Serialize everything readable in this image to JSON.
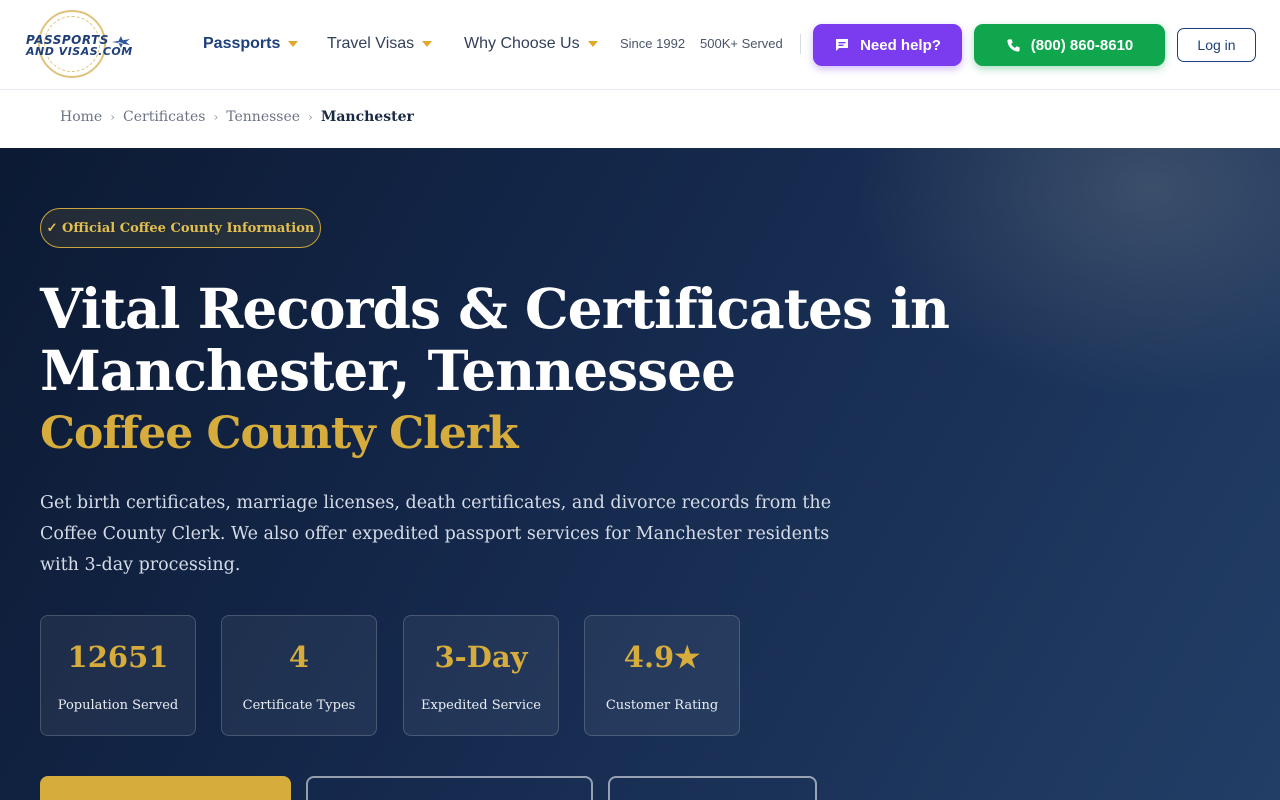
{
  "header": {
    "logo": {
      "line1": "PASSPORTS",
      "line2": "AND VISAS.COM",
      "icon": "plane-icon"
    },
    "nav": [
      {
        "label": "Passports",
        "active": true
      },
      {
        "label": "Travel Visas",
        "active": false
      },
      {
        "label": "Why Choose Us",
        "active": false
      }
    ],
    "since": "Since 1992",
    "served": "500K+ Served",
    "help_label": "Need help?",
    "phone_label": "(800) 860-8610",
    "login_label": "Log in",
    "colors": {
      "help": "#7b3cf0",
      "phone": "#0fa64e",
      "accent": "#d6ad3c"
    }
  },
  "breadcrumb": {
    "items": [
      "Home",
      "Certificates",
      "Tennessee"
    ],
    "current": "Manchester"
  },
  "hero": {
    "badge": "✓ Official Coffee County Information",
    "title": "Vital Records & Certificates in Manchester, Tennessee",
    "subtitle": "Coffee County Clerk",
    "description": "Get birth certificates, marriage licenses, death certificates, and divorce records from the Coffee County Clerk. We also offer expedited passport services for Manchester residents with 3-day processing.",
    "stats": [
      {
        "value": "12651",
        "label": "Population Served"
      },
      {
        "value": "4",
        "label": "Certificate Types"
      },
      {
        "value": "3-Day",
        "label": "Expedited Service"
      },
      {
        "value": "4.9★",
        "label": "Customer Rating"
      }
    ]
  }
}
